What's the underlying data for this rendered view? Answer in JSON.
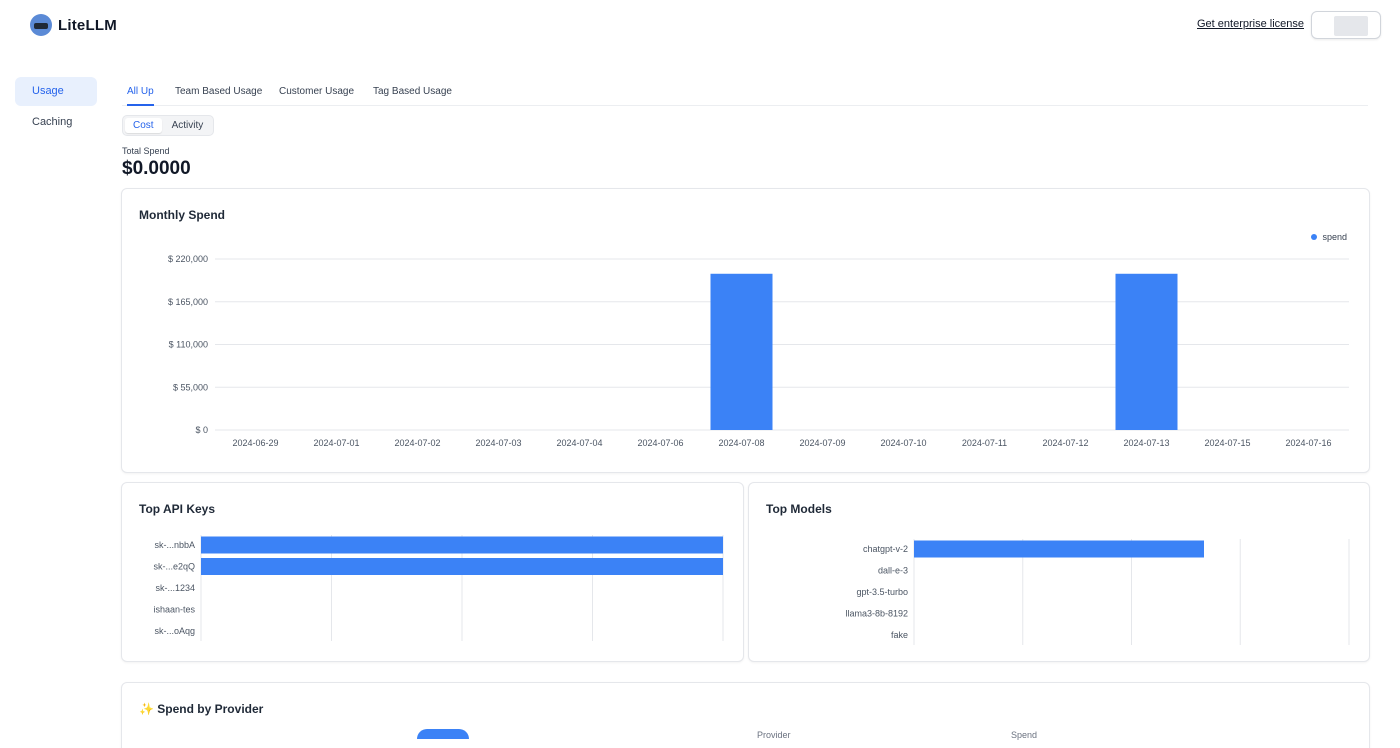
{
  "header": {
    "app_name": "LiteLLM",
    "enterprise_link": "Get enterprise license"
  },
  "sidebar": {
    "items": [
      {
        "label": "Usage",
        "active": true
      },
      {
        "label": "Caching",
        "active": false
      }
    ]
  },
  "tabs": [
    {
      "label": "All Up",
      "active": true
    },
    {
      "label": "Team Based Usage",
      "active": false
    },
    {
      "label": "Customer Usage",
      "active": false
    },
    {
      "label": "Tag Based Usage",
      "active": false
    }
  ],
  "view_toggle": {
    "options": [
      "Cost",
      "Activity"
    ],
    "selected": "Cost"
  },
  "total_spend": {
    "label": "Total Spend",
    "value": "$0.0000"
  },
  "monthly_spend": {
    "title": "Monthly Spend",
    "legend": "spend",
    "y_ticks": [
      "$ 220,000",
      "$ 165,000",
      "$ 110,000",
      "$ 55,000",
      "$ 0"
    ]
  },
  "top_api_keys": {
    "title": "Top API Keys"
  },
  "top_models": {
    "title": "Top Models"
  },
  "spend_by_provider": {
    "title": "Spend by Provider",
    "columns": [
      "Provider",
      "Spend"
    ]
  },
  "colors": {
    "accent": "#3b82f6",
    "active_text": "#2563eb"
  },
  "chart_data": [
    {
      "type": "bar",
      "title": "Monthly Spend",
      "categories": [
        "2024-06-29",
        "2024-07-01",
        "2024-07-02",
        "2024-07-03",
        "2024-07-04",
        "2024-07-06",
        "2024-07-08",
        "2024-07-09",
        "2024-07-10",
        "2024-07-11",
        "2024-07-12",
        "2024-07-13",
        "2024-07-15",
        "2024-07-16"
      ],
      "series": [
        {
          "name": "spend",
          "values": [
            0,
            0,
            0,
            0,
            0,
            0,
            201000,
            0,
            0,
            0,
            0,
            201000,
            0,
            0
          ]
        }
      ],
      "ylim": [
        0,
        220000
      ],
      "legend": "top-right",
      "grid": true
    },
    {
      "type": "bar",
      "orientation": "horizontal",
      "title": "Top API Keys",
      "categories": [
        "sk-...nbbA",
        "sk-...e2qQ",
        "sk-...1234",
        "ishaan-tes",
        "sk-...oAqg"
      ],
      "values": [
        100,
        100,
        0,
        0,
        0
      ],
      "xlim": [
        0,
        100
      ]
    },
    {
      "type": "bar",
      "orientation": "horizontal",
      "title": "Top Models",
      "categories": [
        "chatgpt-v-2",
        "dall-e-3",
        "gpt-3.5-turbo",
        "llama3-8b-8192",
        "fake"
      ],
      "values": [
        80,
        0,
        0,
        0,
        0
      ],
      "xlim": [
        0,
        120
      ]
    }
  ]
}
